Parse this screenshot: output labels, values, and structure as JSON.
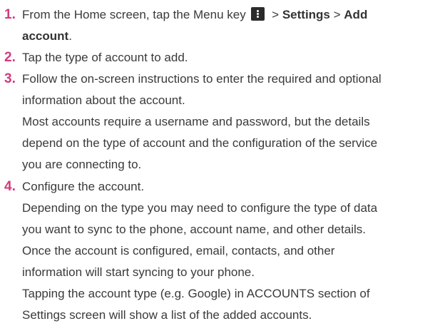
{
  "steps": [
    {
      "number": "1.",
      "line1_pre": "From the Home screen, tap the Menu key",
      "sep1": " > ",
      "settings": "Settings",
      "sep2": " > ",
      "add": "Add",
      "account": "account",
      "period": ".",
      "menu_key_icon": "menu-key-icon"
    },
    {
      "number": "2.",
      "text": "Tap the type of account to add."
    },
    {
      "number": "3.",
      "lines": [
        "Follow the on-screen instructions to enter the required and optional",
        "information about the account.",
        "Most accounts require a username and password, but the details",
        "depend on the type of account and the configuration of the service",
        "you are connecting to."
      ]
    },
    {
      "number": "4.",
      "lines": [
        "Configure the account.",
        "Depending on the type you may need to configure the type of data",
        "you want to sync to the phone, account name, and other details.",
        "Once the account is configured, email, contacts, and other",
        "information will start syncing to your phone.",
        "Tapping the account type (e.g. Google) in ACCOUNTS section of",
        "Settings screen will show a list of the added accounts."
      ]
    }
  ],
  "colors": {
    "step_number": "#d23a7e",
    "body_text": "#3a3a3a",
    "menu_key_bg": "#2b2b2b"
  }
}
